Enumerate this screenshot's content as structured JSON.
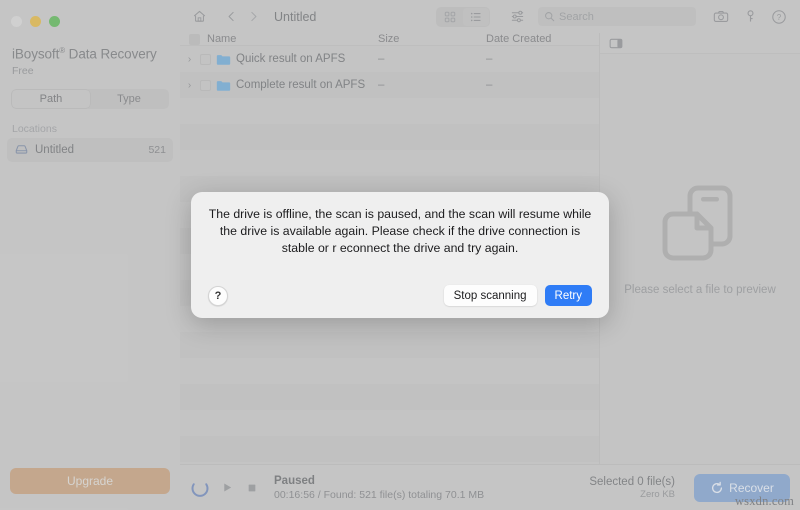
{
  "window": {
    "traffic_lights": [
      "close",
      "minimize",
      "maximize"
    ]
  },
  "sidebar": {
    "brand_name": "iBoysoft",
    "brand_reg": "®",
    "brand_product": " Data Recovery",
    "edition": "Free",
    "segmented": {
      "options": [
        "Path",
        "Type"
      ],
      "selected": "Path"
    },
    "section_label": "Locations",
    "locations": [
      {
        "icon": "drive-icon",
        "name": "Untitled",
        "count": "521"
      }
    ],
    "upgrade_label": "Upgrade"
  },
  "toolbar": {
    "home_icon": "home-icon",
    "back_icon": "chevron-left-icon",
    "forward_icon": "chevron-right-icon",
    "title": "Untitled",
    "view_toggle": {
      "options": [
        "grid-view-icon",
        "list-view-icon"
      ],
      "selected": "list-view-icon"
    },
    "filter_icon": "sliders-icon",
    "search": {
      "icon": "search-icon",
      "placeholder": "Search",
      "value": ""
    },
    "right_icons": [
      "camera-icon",
      "key-icon",
      "help-circle-icon"
    ]
  },
  "file_table": {
    "columns": [
      "Name",
      "Size",
      "Date Created"
    ],
    "rows": [
      {
        "name": "Quick result on APFS",
        "size": "–",
        "date": "–",
        "icon": "folder-icon",
        "expanded": false
      },
      {
        "name": "Complete result on APFS",
        "size": "–",
        "date": "–",
        "icon": "folder-icon",
        "expanded": false
      }
    ]
  },
  "preview": {
    "header_icon": "preview-pane-icon",
    "placeholder_icon": "documents-icon",
    "message": "Please select a file to preview"
  },
  "statusbar": {
    "spinner_icon": "loading-spinner-icon",
    "play_icon": "play-icon",
    "stop_icon": "stop-icon",
    "status": "Paused",
    "detail": "00:16:56 / Found: 521 file(s) totaling 70.1 MB",
    "selected_main": "Selected 0 file(s)",
    "selected_sub": "Zero KB",
    "recover_label": "Recover",
    "recover_icon": "recover-refresh-icon"
  },
  "dialog": {
    "message": "The drive is offline, the scan is paused, and the scan will resume while the drive is available again. Please check if the drive connection is stable or r econnect the drive and try again.",
    "help_label": "?",
    "buttons": [
      {
        "label": "Stop scanning",
        "style": "secondary"
      },
      {
        "label": "Retry",
        "style": "primary"
      }
    ]
  },
  "watermark": {
    "text": "wsxdn.com"
  },
  "colors": {
    "accent_blue": "#2f7cf6",
    "upgrade_tan": "#cdab8c",
    "recover_blue": "#8fadd6",
    "folder_blue": "#7fb4dd",
    "traffic_yellow": "#e6c05a",
    "traffic_green": "#6fc06a"
  }
}
